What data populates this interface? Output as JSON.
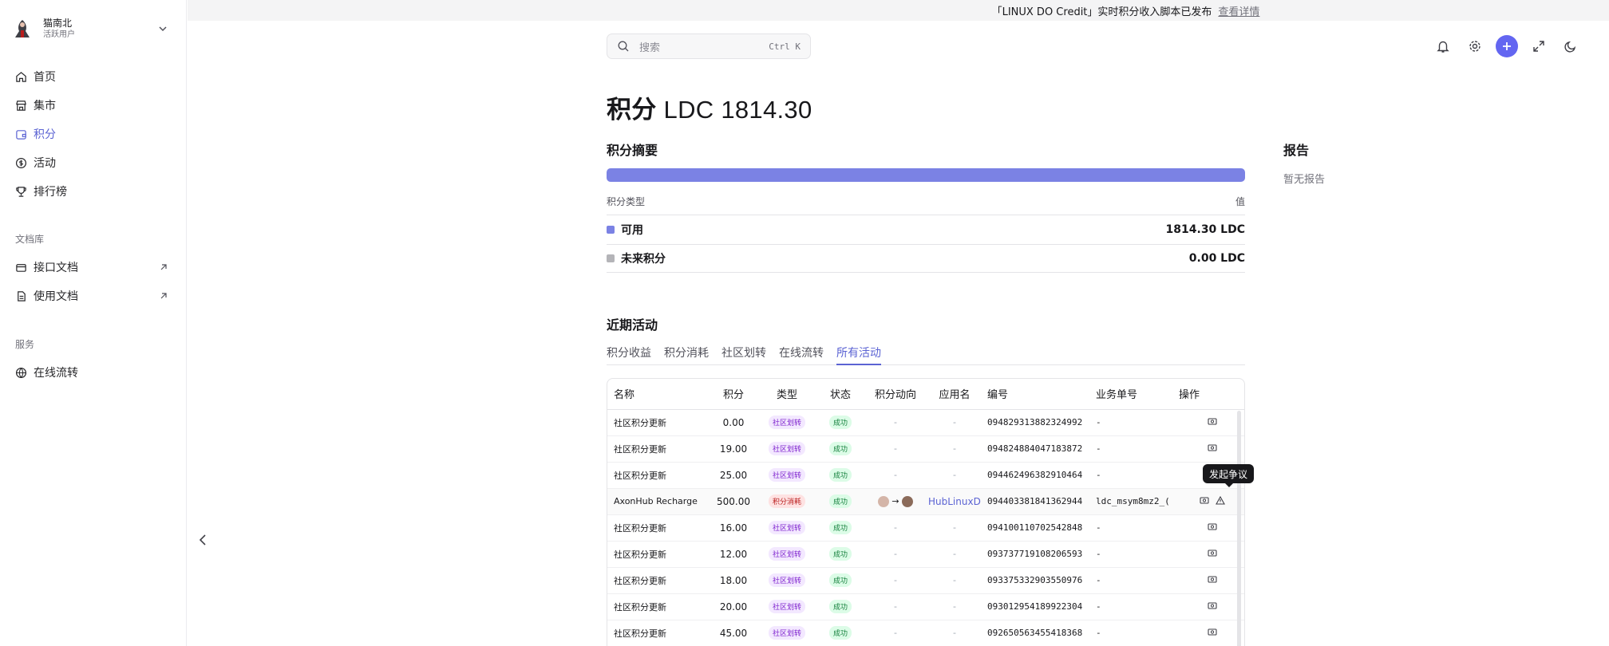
{
  "user": {
    "name": "猫南北",
    "role": "活跃用户"
  },
  "nav": {
    "items": [
      {
        "label": "首页",
        "icon": "home-icon"
      },
      {
        "label": "集市",
        "icon": "store-icon"
      },
      {
        "label": "积分",
        "icon": "wallet-icon",
        "active": true
      },
      {
        "label": "活动",
        "icon": "dollar-circle-icon"
      },
      {
        "label": "排行榜",
        "icon": "trophy-icon"
      }
    ],
    "docs_section": "文档库",
    "docs": [
      {
        "label": "接口文档",
        "icon": "card-icon"
      },
      {
        "label": "使用文档",
        "icon": "file-icon"
      }
    ],
    "services_section": "服务",
    "services": [
      {
        "label": "在线流转",
        "icon": "globe-icon"
      }
    ]
  },
  "banner": {
    "text": "「LINUX DO Credit」实时积分收入脚本已发布",
    "link": "查看详情"
  },
  "search": {
    "placeholder": "搜索",
    "shortcut": "Ctrl K"
  },
  "page": {
    "title_bold": "积分",
    "title_rest": " LDC 1814.30"
  },
  "summary": {
    "title": "积分摘要",
    "progress_available_fraction": 1.0,
    "col_type": "积分类型",
    "col_value": "值",
    "rows": [
      {
        "label": "可用",
        "value": "1814.30 LDC",
        "color": "#7b82e4"
      },
      {
        "label": "未来积分",
        "value": "0.00 LDC",
        "color": "#b4b4b8"
      }
    ]
  },
  "report": {
    "title": "报告",
    "empty": "暂无报告"
  },
  "activity": {
    "title": "近期活动",
    "tabs": [
      "积分收益",
      "积分消耗",
      "社区划转",
      "在线流转",
      "所有活动"
    ],
    "active_tab": "所有活动",
    "columns": [
      "名称",
      "积分",
      "类型",
      "状态",
      "积分动向",
      "应用名",
      "编号",
      "业务单号",
      "操作"
    ],
    "rows": [
      {
        "name": "社区积分更新",
        "amount": "0.00",
        "type": "社区划转",
        "status": "成功",
        "flow": "-",
        "app": "-",
        "id": "094829313882324992",
        "biz": "-"
      },
      {
        "name": "社区积分更新",
        "amount": "19.00",
        "type": "社区划转",
        "status": "成功",
        "flow": "-",
        "app": "-",
        "id": "094824884047183872",
        "biz": "-"
      },
      {
        "name": "社区积分更新",
        "amount": "25.00",
        "type": "社区划转",
        "status": "成功",
        "flow": "-",
        "app": "-",
        "id": "094462496382910464",
        "biz": "-"
      },
      {
        "name": "AxonHub Recharge",
        "amount": "500.00",
        "type": "积分消耗",
        "status": "成功",
        "flow": "→",
        "app": "HubLinuxDo",
        "id": "094403381841362944",
        "biz": "ldc_msym8mz2_("
      },
      {
        "name": "社区积分更新",
        "amount": "16.00",
        "type": "社区划转",
        "status": "成功",
        "flow": "-",
        "app": "-",
        "id": "094100110702542848",
        "biz": "-"
      },
      {
        "name": "社区积分更新",
        "amount": "12.00",
        "type": "社区划转",
        "status": "成功",
        "flow": "-",
        "app": "-",
        "id": "093737719108206593",
        "biz": "-"
      },
      {
        "name": "社区积分更新",
        "amount": "18.00",
        "type": "社区划转",
        "status": "成功",
        "flow": "-",
        "app": "-",
        "id": "093375332903550976",
        "biz": "-"
      },
      {
        "name": "社区积分更新",
        "amount": "20.00",
        "type": "社区划转",
        "status": "成功",
        "flow": "-",
        "app": "-",
        "id": "093012954189922304",
        "biz": "-"
      },
      {
        "name": "社区积分更新",
        "amount": "45.00",
        "type": "社区划转",
        "status": "成功",
        "flow": "-",
        "app": "-",
        "id": "092650563455418368",
        "biz": "-"
      }
    ]
  },
  "tooltip": "发起争议",
  "colors": {
    "accent": "#5b63d3",
    "bar": "#7b82e4",
    "plus_button": "#6366f1"
  }
}
